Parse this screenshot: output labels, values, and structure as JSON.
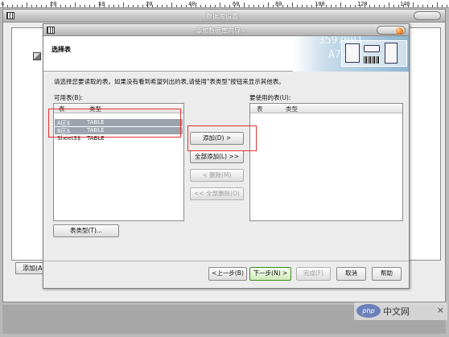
{
  "ruler": {
    "labels": [
      "4",
      "20",
      "10",
      "20",
      "40",
      "60",
      "80",
      "100",
      "120",
      "140"
    ]
  },
  "outer_window": {
    "title": "数据库设置",
    "add_button_label": "添加(A"
  },
  "wizard": {
    "title": "添加数据库向导 -",
    "banner_title": "选择表",
    "banner_art_numbers": [
      "3597001",
      "A7-11"
    ],
    "instruction": "请选择您要读取的表。如果没有看到希望列出的表,请使用\"表类型\"按钮来显示其他表。",
    "available_label": "可用表(B):",
    "used_label": "要使用的表(U):",
    "columns": {
      "table": "表",
      "type": "类型"
    },
    "available_tables": [
      {
        "name": "A区$",
        "type": "TABLE",
        "selected": true
      },
      {
        "name": "B区$",
        "type": "TABLE",
        "selected": true
      },
      {
        "name": "Sheet3$",
        "type": "TABLE",
        "selected": false
      }
    ],
    "used_tables": [],
    "middle_buttons": {
      "add": "添加(D) >",
      "add_all": "全部添加(L) >>",
      "remove": "< 删除(M)",
      "remove_all": "<< 全部删除(O)"
    },
    "table_types_button": "表类型(T)...",
    "footer_buttons": {
      "back": "<上一步(B)",
      "next": "下一步(N) >",
      "finish": "完成(F)",
      "cancel": "取消",
      "help": "帮助"
    }
  },
  "watermark": {
    "logo": "php",
    "text": "中文网",
    "close": "×"
  },
  "colors": {
    "selection": "#9ca3ad",
    "annotation": "#e23333",
    "next_button_border": "#3c8a26"
  }
}
